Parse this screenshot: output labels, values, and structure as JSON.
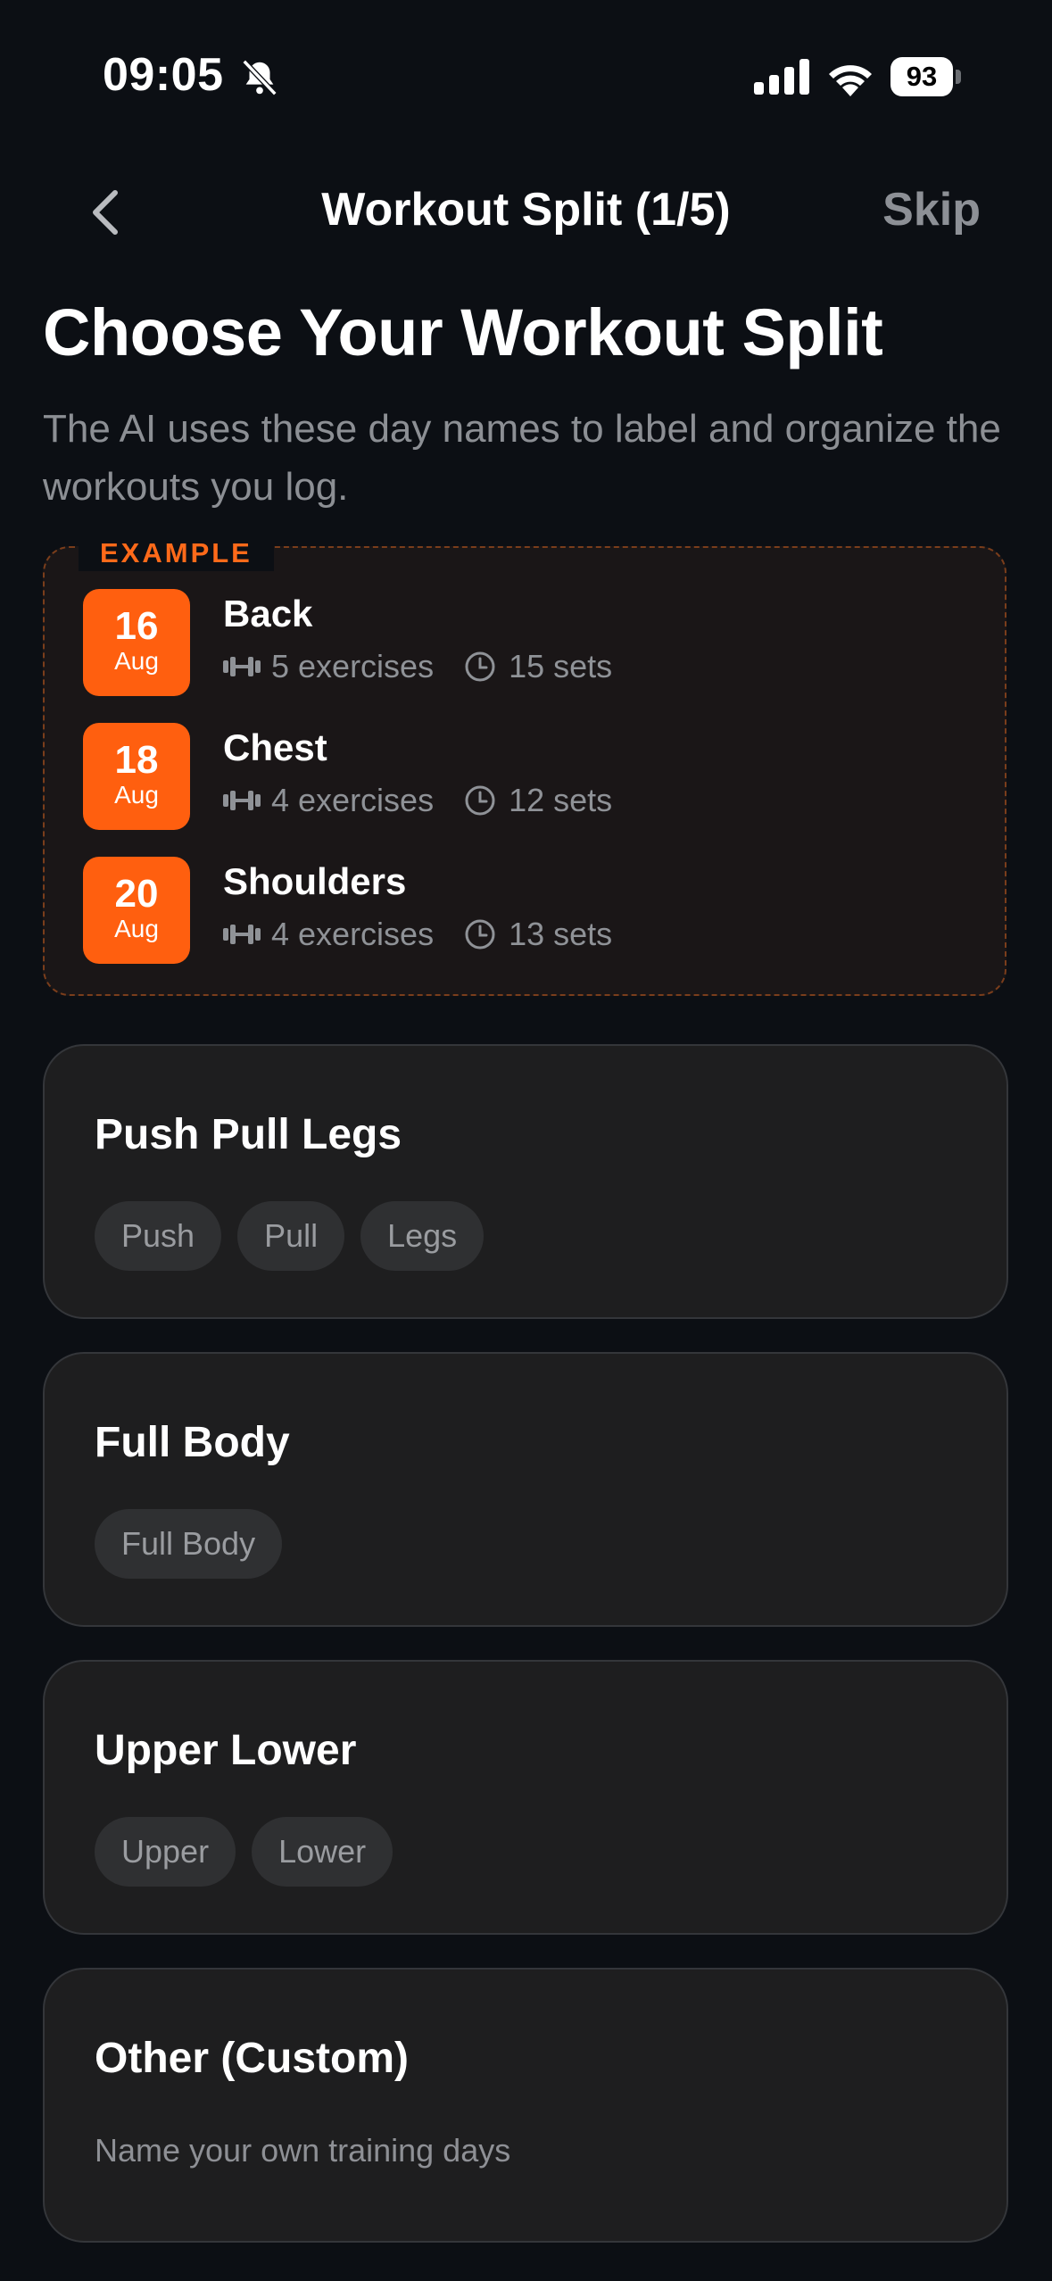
{
  "status_bar": {
    "time": "09:05",
    "battery": "93"
  },
  "nav": {
    "title": "Workout Split (1/5)",
    "skip_label": "Skip"
  },
  "heading": {
    "title": "Choose Your Workout Split",
    "subtitle": "The AI uses these day names to label and organize the workouts you log."
  },
  "example": {
    "label": "EXAMPLE",
    "items": [
      {
        "day": "16",
        "month": "Aug",
        "name": "Back",
        "exercises": "5 exercises",
        "sets": "15 sets"
      },
      {
        "day": "18",
        "month": "Aug",
        "name": "Chest",
        "exercises": "4 exercises",
        "sets": "12 sets"
      },
      {
        "day": "20",
        "month": "Aug",
        "name": "Shoulders",
        "exercises": "4 exercises",
        "sets": "13 sets"
      }
    ]
  },
  "options": [
    {
      "title": "Push Pull Legs",
      "chips": [
        "Push",
        "Pull",
        "Legs"
      ]
    },
    {
      "title": "Full Body",
      "chips": [
        "Full Body"
      ]
    },
    {
      "title": "Upper Lower",
      "chips": [
        "Upper",
        "Lower"
      ]
    },
    {
      "title": "Other (Custom)",
      "description": "Name your own training days"
    }
  ],
  "colors": {
    "accent": "#ff5f0f",
    "background": "#0c0f14",
    "card": "#1e1e1f"
  },
  "icons": [
    "bell-slash-icon",
    "signal-icon",
    "wifi-icon",
    "battery-icon",
    "chevron-left-icon",
    "dumbbell-icon",
    "clock-icon"
  ]
}
